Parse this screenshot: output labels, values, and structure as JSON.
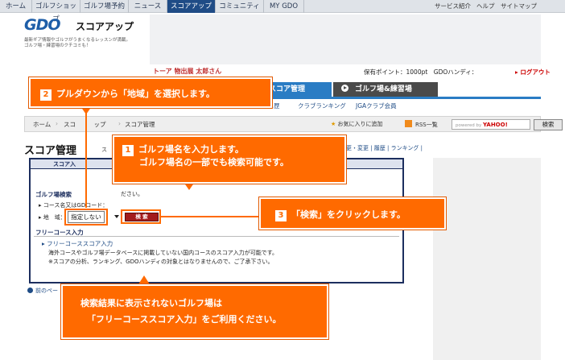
{
  "topnav": {
    "items": [
      "ホーム",
      "ゴルフショップ",
      "ゴルフ場予約",
      "ニュース",
      "スコアアップ",
      "コミュニティ",
      "MY GDO"
    ],
    "active_index": 4,
    "utils": [
      "サービス紹介",
      "ヘルプ",
      "サイトマップ"
    ]
  },
  "logo": {
    "brand": "GDO",
    "sub": "スコアアップ",
    "tagline1": "最新ギア情報やゴルフがうまくなるレッスンが満載。",
    "tagline2": "ゴルフ場・練習場のクチコミも！"
  },
  "header": {
    "user": "トーア 物出展 太郎さん",
    "points": "保有ポイント：1000pt　GDOハンディ：",
    "logout": "ログアウト"
  },
  "tabs": {
    "score": "スコア管理",
    "course": "ゴルフ場&練習場"
  },
  "subnav": [
    "歴",
    "クラブランキング",
    "JGAクラブ会員"
  ],
  "breadcrumb": {
    "home": "ホーム",
    "mid": "スコ　　　ップ",
    "current": "スコア管理",
    "fav": "お気に入りに追加",
    "rss": "RSS一覧",
    "yahoo_powered": "powered by",
    "yahoo_brand": "YAHOO!",
    "search": "検索"
  },
  "page": {
    "title": "スコア管理",
    "title_tail": "ス",
    "right_links": "更・変更 | 履歴 | ランキング |"
  },
  "form": {
    "panel_title": "スコア入",
    "golf_label": "ゴルフ場検索",
    "row1": "コース名又はGDコード：",
    "row2": "地　域：",
    "desc_top": "ださい。",
    "select_value": "指定しない",
    "search_button": "検 索",
    "free_label": "フリーコース入力",
    "free_link": "フリーコーススコア入力",
    "free_desc1": "海外コースやゴルフ場データベースに掲載していない国内コースのスコア入力が可能です。",
    "free_desc2": "※スコアの分析、ランキング、GDOハンディの対象とはなりませんので、ご了承下さい。"
  },
  "prev": "前のペー",
  "callouts": {
    "c2": {
      "num": "2",
      "text": "プルダウンから「地域」を選択します。"
    },
    "c1": {
      "num": "1",
      "line1": "ゴルフ場名を入力します。",
      "line2": "ゴルフ場名の一部でも検索可能です。"
    },
    "c3": {
      "num": "3",
      "text": "「検索」をクリックします。"
    },
    "c4": {
      "line1": "検索結果に表示されないゴルフ場は",
      "line2": "「フリーコーススコア入力」をご利用ください。"
    }
  },
  "colors": {
    "callout": "#ff6a00",
    "nav_active": "#1f4c86",
    "tab_blue": "#2a7cc4"
  }
}
